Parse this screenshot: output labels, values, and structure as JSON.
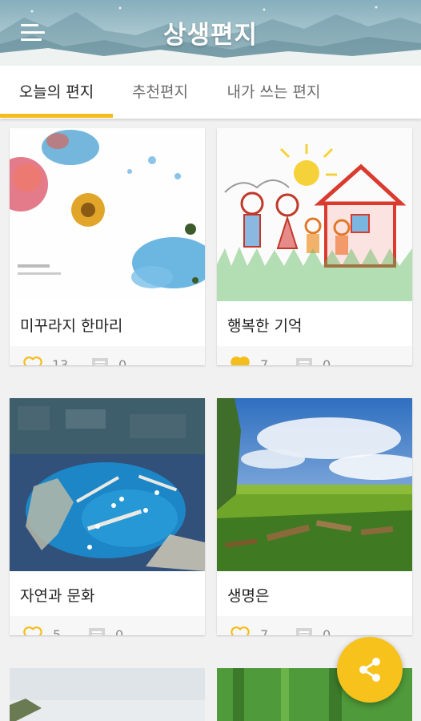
{
  "app_bar": {
    "title": "상생편지",
    "menu_icon": "hamburger-menu-icon"
  },
  "tabs": [
    {
      "label": "오늘의 편지",
      "active": true
    },
    {
      "label": "추천편지",
      "active": false
    },
    {
      "label": "내가 쓰는 편지",
      "active": false
    }
  ],
  "colors": {
    "accent": "#f3be1c",
    "fab": "#f6c21b",
    "text": "#222222",
    "muted": "#8a8a8a"
  },
  "cards": [
    {
      "title": "미꾸라지 한마리",
      "likes": "13",
      "comments": "0",
      "liked": false,
      "image": "watercolor-flowers"
    },
    {
      "title": "행복한 기억",
      "likes": "7",
      "comments": "0",
      "liked": true,
      "image": "child-drawing-family-house"
    },
    {
      "title": "자연과 문화",
      "likes": "5",
      "comments": "0",
      "liked": false,
      "image": "aerial-harbor-marina"
    },
    {
      "title": "생명은",
      "likes": "7",
      "comments": "0",
      "liked": false,
      "image": "green-field-boats-sky"
    }
  ],
  "fab": {
    "icon": "share-icon"
  }
}
